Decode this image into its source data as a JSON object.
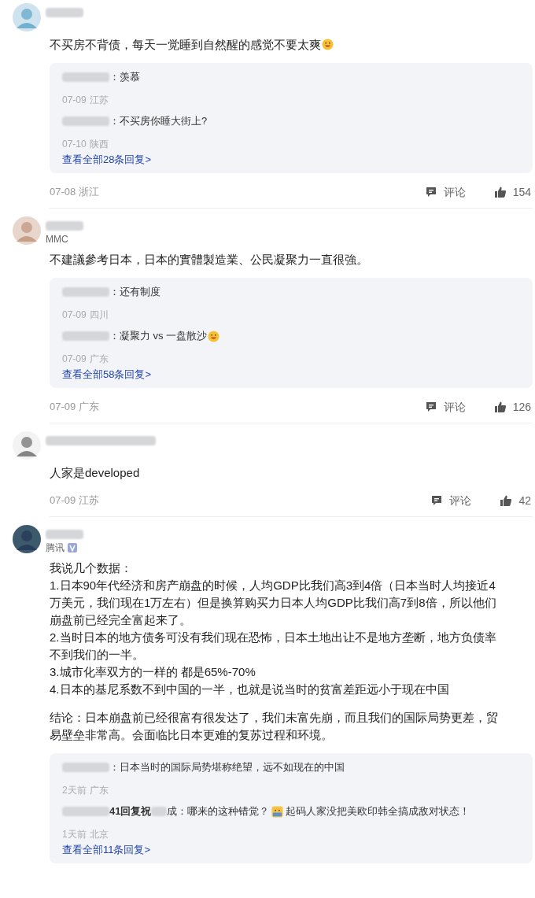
{
  "comments": [
    {
      "avatar": {
        "kind": "person"
      },
      "paragraphs": [
        [
          "不买房不背债，每天一觉睡到自然醒的感觉不要太爽"
        ]
      ],
      "emoji": {
        "kind": "grin"
      },
      "replies": [
        {
          "text": "：羡慕",
          "date": "07-09",
          "region": "江苏"
        },
        {
          "text": "：不买房你睡大街上?",
          "date": "07-10",
          "region": "陕西"
        }
      ],
      "more": "查看全部28条回复>",
      "date": "07-08",
      "region": "浙江",
      "comment_label": "评论",
      "likes": "154"
    },
    {
      "avatar": {
        "kind": "face"
      },
      "tag": "MMC",
      "paragraphs": [
        [
          "不建議參考日本，日本的實體製造業、公民凝聚力一直很強。"
        ]
      ],
      "replies": [
        {
          "text": "：还有制度",
          "date": "07-09",
          "region": "四川"
        },
        {
          "text": "：凝聚力 vs 一盘散沙",
          "emoji": {
            "kind": "grin"
          },
          "date": "07-09",
          "region": "广东"
        }
      ],
      "more": "查看全部58条回复>",
      "date": "07-09",
      "region": "广东",
      "comment_label": "评论",
      "likes": "126"
    },
    {
      "avatar": {
        "kind": "sketch"
      },
      "paragraphs": [
        [
          "人家是developed"
        ]
      ],
      "date": "07-09",
      "region": "江苏",
      "comment_label": "评论",
      "likes": "42"
    },
    {
      "avatar": {
        "kind": "dark"
      },
      "tag": "腾讯",
      "verified": true,
      "paragraphs": [
        [
          "我说几个数据：",
          "1.日本90年代经济和房产崩盘的时候，人均GDP比我们高3到4倍（日本当时人均接近4万美元，我们现在1万左右）但是换算购买力日本人均GDP比我们高7到8倍，所以他们崩盘前已经完全富起来了。",
          "2.当时日本的地方债务可没有我们现在恐怖，日本土地出让不是地方垄断，地方负债率不到我们的一半。",
          "3.城市化率双方的一样的 都是65%-70%",
          "4.日本的基尼系数不到中国的一半，也就是说当时的贫富差距远小于现在中国"
        ],
        [
          "结论：日本崩盘前已经很富有很发达了，我们未富先崩，而且我们的国际局势更差，贸易壁垒非常高。会面临比日本更难的复苏过程和环境。"
        ]
      ],
      "replies": [
        {
          "text": "：日本当时的国际局势堪称绝望，远不如现在的中国",
          "date": "2天前",
          "region": "广东"
        },
        {
          "text": "41回复祝",
          "text2": "成：哪来的这种错觉？",
          "emoji": {
            "kind": "sticker"
          },
          "text_after": "起码人家没把美欧印韩全搞成敌对状态！",
          "date": "1天前",
          "region": "北京"
        }
      ],
      "more": "查看全部11条回复>"
    }
  ]
}
